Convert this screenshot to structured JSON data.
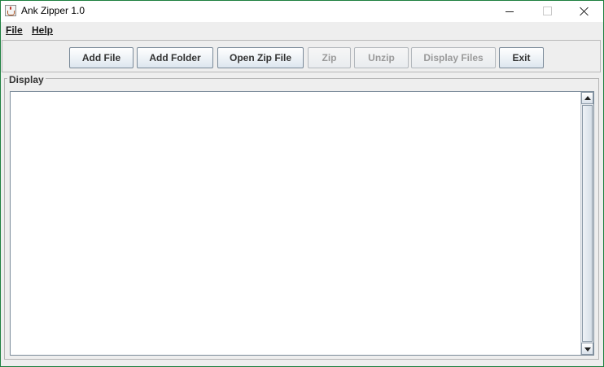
{
  "window": {
    "title": "Ank Zipper 1.0"
  },
  "menubar": {
    "items": [
      {
        "label": "File"
      },
      {
        "label": "Help"
      }
    ]
  },
  "toolbar": {
    "buttons": [
      {
        "label": "Add File",
        "enabled": true
      },
      {
        "label": "Add Folder",
        "enabled": true
      },
      {
        "label": "Open Zip File",
        "enabled": true
      },
      {
        "label": "Zip",
        "enabled": false
      },
      {
        "label": "Unzip",
        "enabled": false
      },
      {
        "label": "Display Files",
        "enabled": false
      },
      {
        "label": "Exit",
        "enabled": true
      }
    ]
  },
  "display": {
    "legend": "Display",
    "content": ""
  },
  "icons": {
    "app": "java-cup-icon",
    "minimize": "minimize-icon",
    "maximize": "maximize-icon",
    "close": "close-icon",
    "scroll_up": "scroll-up-arrow-icon",
    "scroll_down": "scroll-down-arrow-icon"
  },
  "colors": {
    "window_border": "#1d7f3f",
    "button_gradient_top": "#ffffff",
    "button_gradient_bottom": "#dde6ef",
    "disabled_text": "#9a9a9a"
  }
}
